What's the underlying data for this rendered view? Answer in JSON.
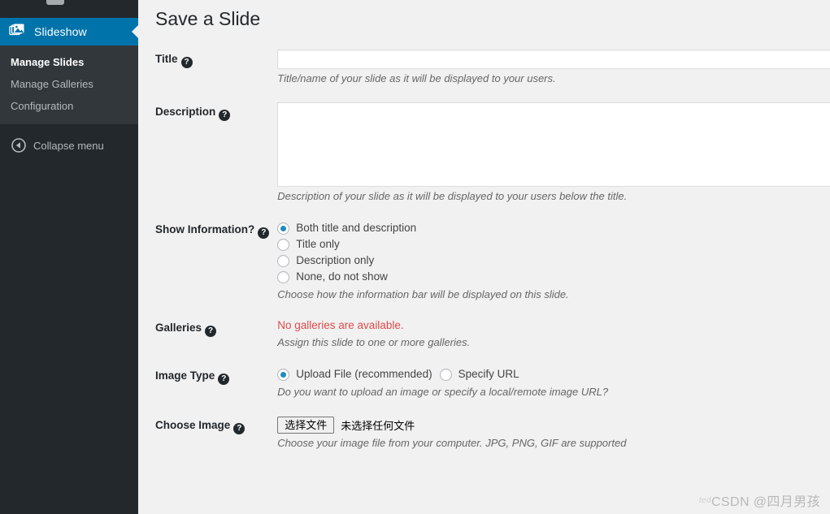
{
  "sidebar": {
    "active_item": {
      "label": "Slideshow",
      "icon": "images-stack-icon"
    },
    "submenu": [
      {
        "label": "Manage Slides",
        "current": true
      },
      {
        "label": "Manage Galleries",
        "current": false
      },
      {
        "label": "Configuration",
        "current": false
      }
    ],
    "collapse": {
      "label": "Collapse menu",
      "icon": "collapse-left-arrow-icon"
    },
    "colors": {
      "background": "#23282d",
      "submenu_background": "#32373c",
      "active": "#0073aa"
    }
  },
  "page": {
    "title": "Save a Slide"
  },
  "form": {
    "title_field": {
      "label": "Title",
      "help": "?",
      "value": "",
      "placeholder": "",
      "description": "Title/name of your slide as it will be displayed to your users."
    },
    "description_field": {
      "label": "Description",
      "help": "?",
      "value": "",
      "placeholder": "",
      "description": "Description of your slide as it will be displayed to your users below the title."
    },
    "show_information": {
      "label": "Show Information?",
      "help": "?",
      "options": [
        {
          "label": "Both title and description",
          "checked": true
        },
        {
          "label": "Title only",
          "checked": false
        },
        {
          "label": "Description only",
          "checked": false
        },
        {
          "label": "None, do not show",
          "checked": false
        }
      ],
      "description": "Choose how the information bar will be displayed on this slide."
    },
    "galleries": {
      "label": "Galleries",
      "help": "?",
      "error": "No galleries are available.",
      "error_color": "#e04b4b",
      "description": "Assign this slide to one or more galleries."
    },
    "image_type": {
      "label": "Image Type",
      "help": "?",
      "options": [
        {
          "label": "Upload File (recommended)",
          "checked": true
        },
        {
          "label": "Specify URL",
          "checked": false
        }
      ],
      "description": "Do you want to upload an image or specify a local/remote image URL?"
    },
    "choose_image": {
      "label": "Choose Image",
      "help": "?",
      "button_label": "选择文件",
      "file_status": "未选择任何文件",
      "description": "Choose your image file from your computer. JPG, PNG, GIF are supported"
    }
  },
  "watermark": {
    "ghost": "ted",
    "text": "CSDN @四月男孩"
  }
}
